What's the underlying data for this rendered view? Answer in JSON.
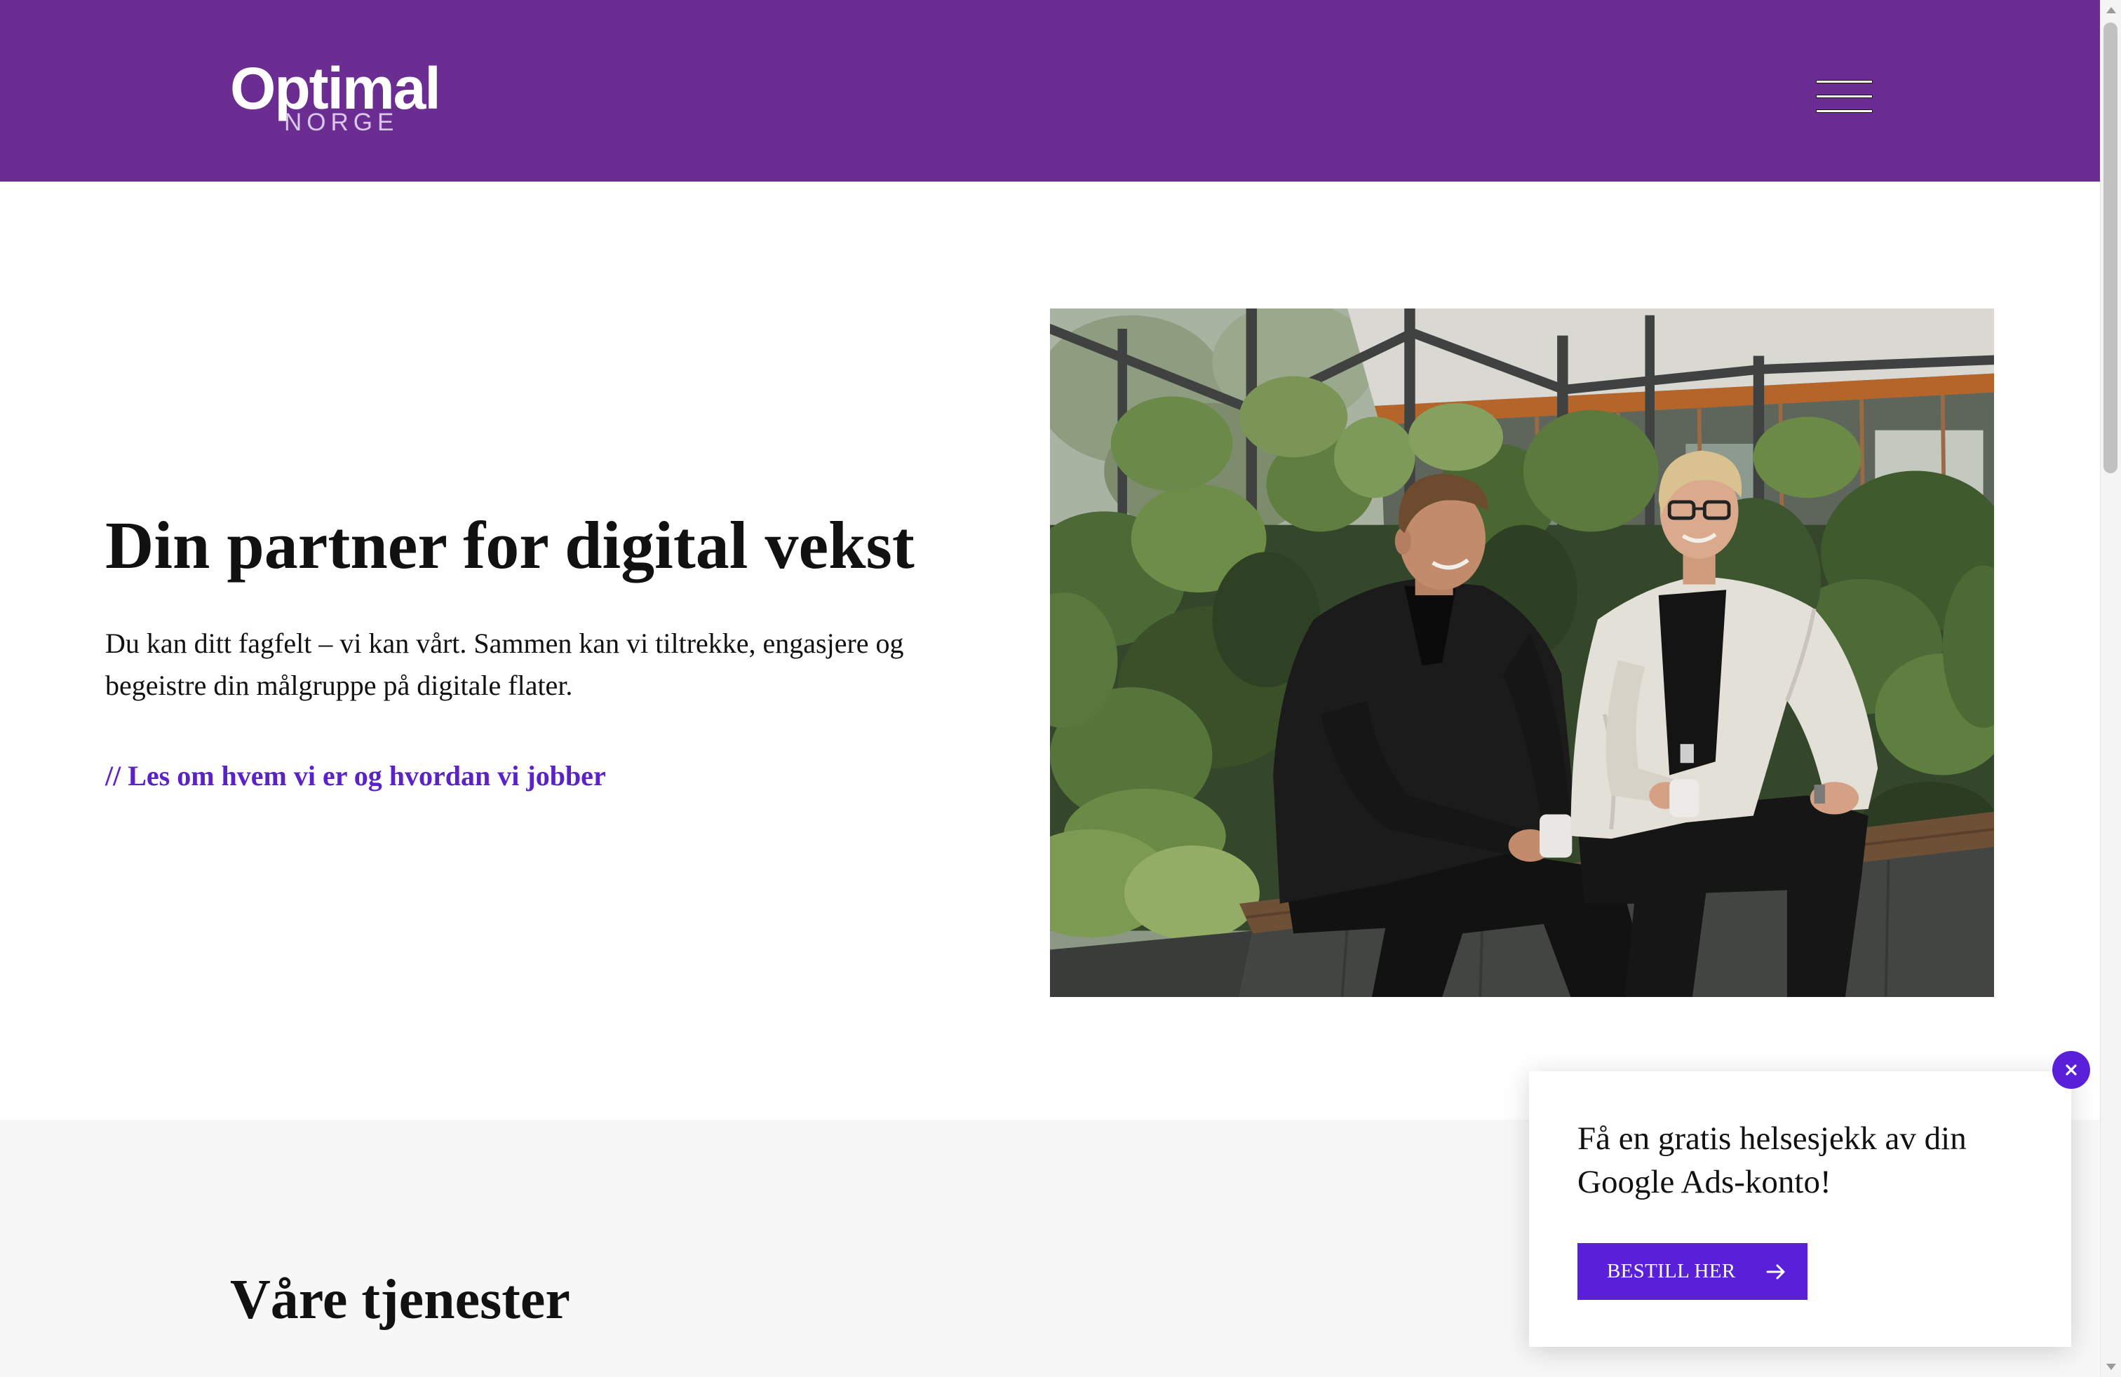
{
  "header": {
    "logo": {
      "main": "Optimal",
      "sub": "NORGE"
    },
    "menu_icon": "hamburger-menu-icon"
  },
  "hero": {
    "title": "Din partner for digital vekst",
    "description": "Du kan ditt fagfelt – vi kan vårt. Sammen kan vi tiltrekke, engasjere og begeistre din målgruppe på digitale flater.",
    "link_label": "// Les om hvem vi er og hvordan vi jobber"
  },
  "services": {
    "title": "Våre tjenester"
  },
  "popup": {
    "message": "Få en gratis helsesjekk av din Google Ads-konto!",
    "button_label": "BESTILL HER",
    "button_icon": "arrow-right-icon",
    "close_icon": "close-icon"
  },
  "colors": {
    "header_bg": "#6b2d91",
    "link": "#5b22c9",
    "cta": "#5a1fd8",
    "section_bg": "#f7f7f7",
    "text": "#111111"
  }
}
